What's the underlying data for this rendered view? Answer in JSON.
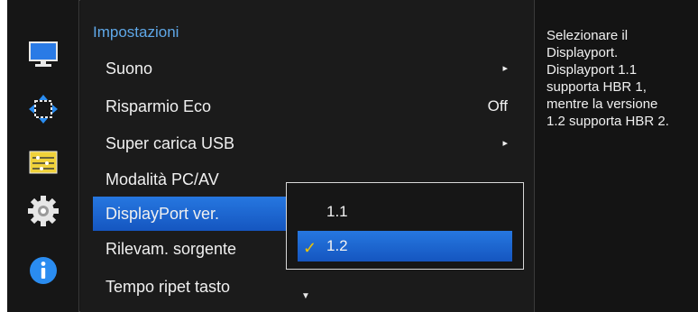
{
  "menu": {
    "title": "Impostazioni",
    "items": [
      {
        "label": "Suono",
        "value": "",
        "arrow": "▸"
      },
      {
        "label": "Risparmio Eco",
        "value": "Off",
        "arrow": ""
      },
      {
        "label": "Super carica USB",
        "value": "",
        "arrow": "▸"
      },
      {
        "label": "Modalità PC/AV",
        "value": "",
        "arrow": ""
      },
      {
        "label": "DisplayPort ver.",
        "value": "",
        "arrow": ""
      },
      {
        "label": "Rilevam. sorgente",
        "value": "",
        "arrow": ""
      },
      {
        "label": "Tempo ripet tasto",
        "value": "",
        "arrow": ""
      }
    ],
    "scroll_down_glyph": "▼"
  },
  "submenu": {
    "options": [
      {
        "label": "1.1",
        "checked": false
      },
      {
        "label": "1.2",
        "checked": true
      }
    ],
    "check_glyph": "✓"
  },
  "help": {
    "lines": [
      "Selezionare il",
      "Displayport.",
      "Displayport 1.1",
      "supporta HBR 1,",
      "mentre la versione",
      "1.2 supporta HBR 2."
    ]
  },
  "rail": {
    "icons": [
      "monitor-icon",
      "resize-arrows-icon",
      "sliders-icon",
      "gear-icon",
      "info-icon"
    ]
  },
  "colors": {
    "accent_blue": "#1f6fd8",
    "title_blue": "#5fa8e8",
    "check_yellow": "#f0c400"
  }
}
